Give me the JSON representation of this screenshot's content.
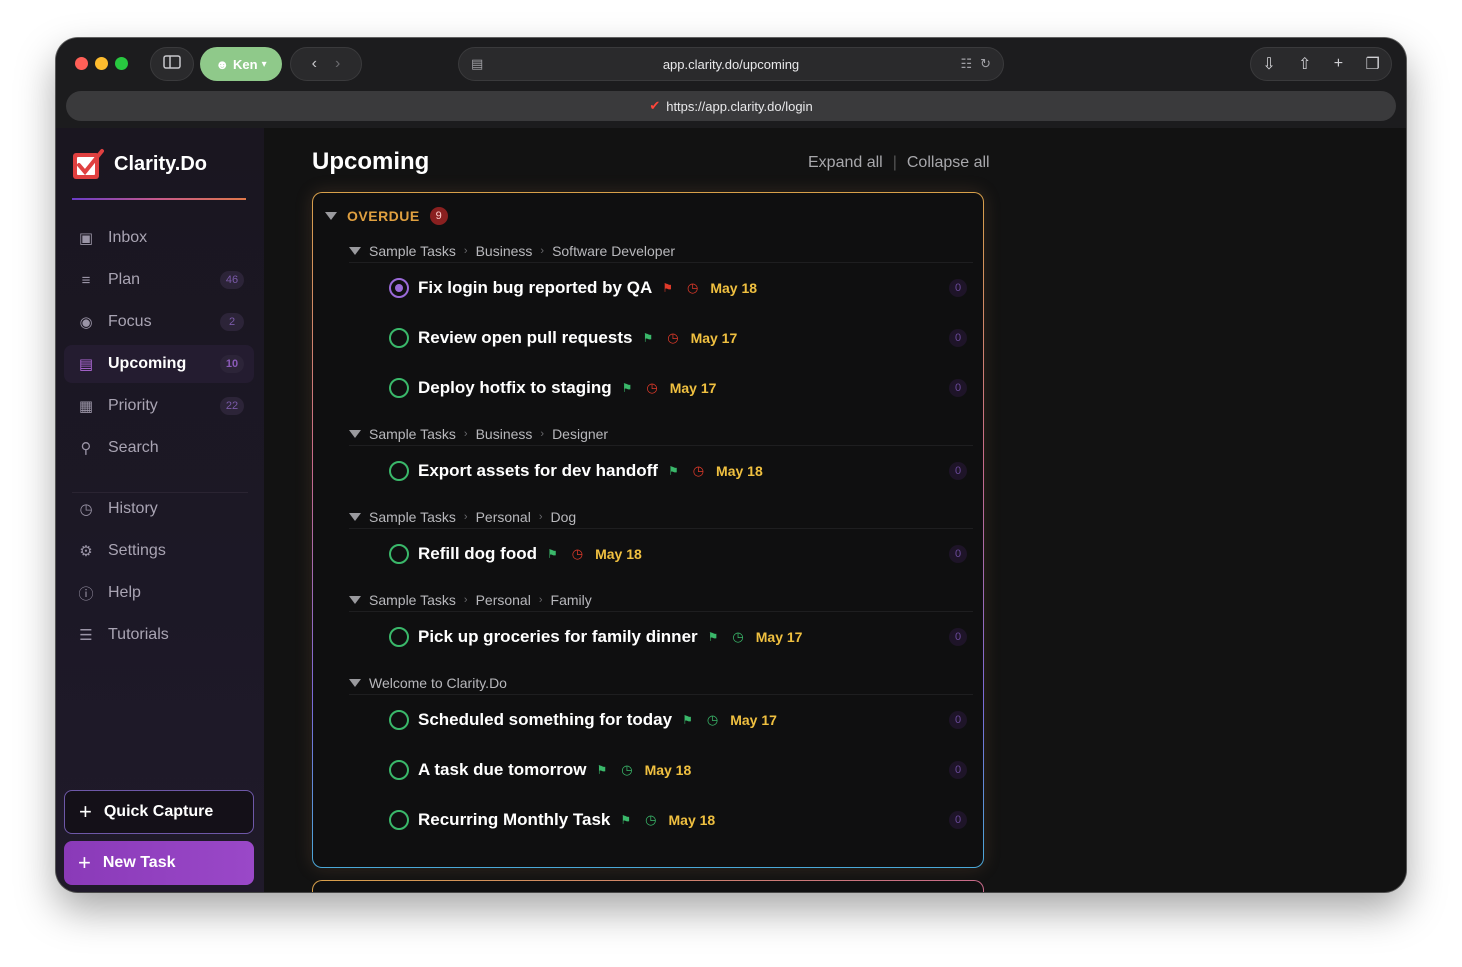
{
  "browser": {
    "profile_name": "Ken",
    "url": "app.clarity.do/upcoming",
    "sub_url": "https://app.clarity.do/login",
    "colors": {
      "close": "#ff5f57",
      "minimize": "#febc2e",
      "zoom": "#28c840"
    }
  },
  "app": {
    "name": "Clarity.Do"
  },
  "sidebar": {
    "items": [
      {
        "label": "Inbox",
        "icon": "inbox-icon",
        "count": ""
      },
      {
        "label": "Plan",
        "icon": "list-icon",
        "count": "46"
      },
      {
        "label": "Focus",
        "icon": "target-icon",
        "count": "2"
      },
      {
        "label": "Upcoming",
        "icon": "calendar-icon",
        "count": "10",
        "active": true
      },
      {
        "label": "Priority",
        "icon": "grid-icon",
        "count": "22"
      },
      {
        "label": "Search",
        "icon": "search-icon",
        "count": ""
      },
      {
        "label": "History",
        "icon": "clock-icon",
        "count": ""
      },
      {
        "label": "Settings",
        "icon": "gear-icon",
        "count": ""
      },
      {
        "label": "Help",
        "icon": "help-icon",
        "count": ""
      },
      {
        "label": "Tutorials",
        "icon": "doc-icon",
        "count": ""
      }
    ],
    "quick_capture": "Quick Capture",
    "new_task": "New Task"
  },
  "main": {
    "title": "Upcoming",
    "expand_all": "Expand all",
    "collapse_all": "Collapse all",
    "section": {
      "label": "OVERDUE",
      "count": "9"
    },
    "groups": [
      {
        "crumbs": [
          "Sample Tasks",
          "Business",
          "Software Developer"
        ]
      },
      {
        "crumbs": [
          "Sample Tasks",
          "Business",
          "Designer"
        ]
      },
      {
        "crumbs": [
          "Sample Tasks",
          "Personal",
          "Dog"
        ]
      },
      {
        "crumbs": [
          "Sample Tasks",
          "Personal",
          "Family"
        ]
      },
      {
        "crumbs": [
          "Welcome to Clarity.Do"
        ]
      }
    ],
    "tasks": [
      {
        "title": "Fix login bug reported by QA",
        "date": "May 18",
        "count": "0",
        "flag_color": "#e03a2a",
        "clock_color": "#e03a2a"
      },
      {
        "title": "Review open pull requests",
        "date": "May 17",
        "count": "0",
        "flag_color": "#3ab86a",
        "clock_color": "#e03a2a"
      },
      {
        "title": "Deploy hotfix to staging",
        "date": "May 17",
        "count": "0",
        "flag_color": "#3ab86a",
        "clock_color": "#e03a2a"
      },
      {
        "title": "Export assets for dev handoff",
        "date": "May 18",
        "count": "0",
        "flag_color": "#3ab86a",
        "clock_color": "#e03a2a"
      },
      {
        "title": "Refill dog food",
        "date": "May 18",
        "count": "0",
        "flag_color": "#3ab86a",
        "clock_color": "#e03a2a"
      },
      {
        "title": "Pick up groceries for family dinner",
        "date": "May 17",
        "count": "0",
        "flag_color": "#3ab86a",
        "clock_color": "#3ab86a"
      },
      {
        "title": "Scheduled something for today",
        "date": "May 17",
        "count": "0",
        "flag_color": "#3ab86a",
        "clock_color": "#3ab86a"
      },
      {
        "title": "A task due tomorrow",
        "date": "May 18",
        "count": "0",
        "flag_color": "#3ab86a",
        "clock_color": "#3ab86a"
      },
      {
        "title": "Recurring Monthly Task",
        "date": "May 18",
        "count": "0",
        "flag_color": "#3ab86a",
        "clock_color": "#3ab86a"
      }
    ]
  }
}
